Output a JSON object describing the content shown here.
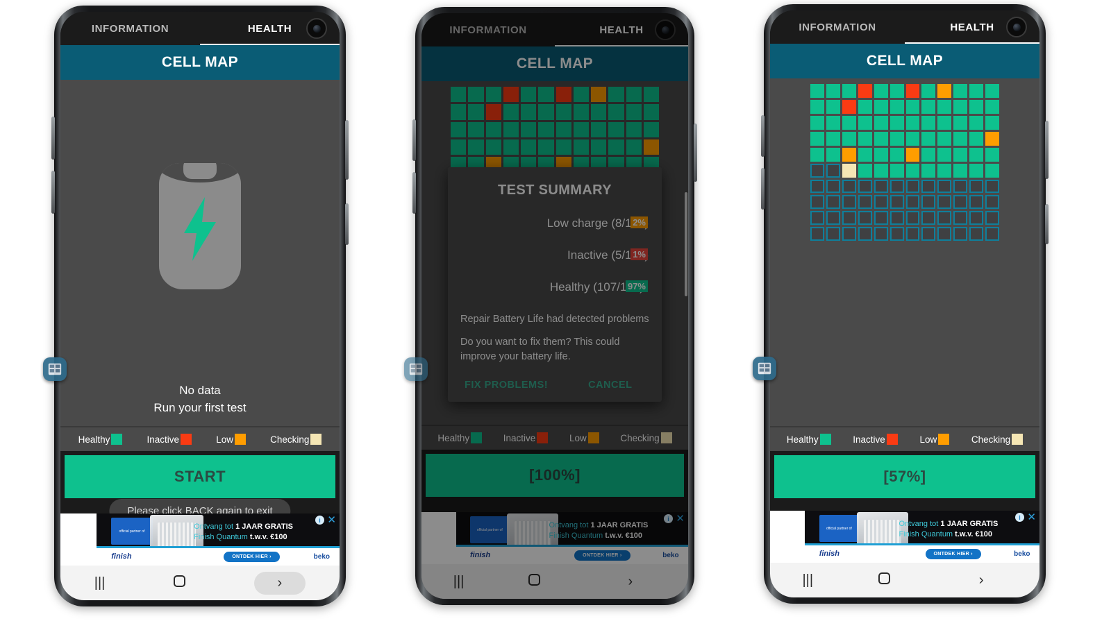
{
  "app": {
    "tabs": {
      "information": "INFORMATION",
      "health": "HEALTH"
    },
    "section_header": "CELL MAP",
    "legend": [
      {
        "label": "Healthy",
        "color": "#0ec18e"
      },
      {
        "label": "Inactive",
        "color": "#fa3b13"
      },
      {
        "label": "Low",
        "color": "#ff9d00"
      },
      {
        "label": "Checking",
        "color": "#f5e6b4"
      }
    ],
    "bubble_icon": "cell-map-widget-icon",
    "camera_icon": "front-camera-icon"
  },
  "phone1": {
    "empty_state": {
      "line1": "No data",
      "line2": "Run your first test",
      "icon": "battery-charging-icon"
    },
    "action_button": "START",
    "toast": "Please click BACK again to exit"
  },
  "phone2": {
    "action_button": "[100%]",
    "dialog": {
      "title": "TEST SUMMARY",
      "stats": [
        {
          "label": "Low charge (8/120)",
          "percent": "2%",
          "color": "#ff9d00"
        },
        {
          "label": "Inactive (5/120)",
          "percent": "1%",
          "color": "#e8453c"
        },
        {
          "label": "Healthy (107/120)",
          "percent": "97%",
          "color": "#0ec18e"
        }
      ],
      "paragraph1": "Repair Battery Life had detected problems",
      "paragraph2": "Do you want to fix them? This could improve your battery life.",
      "confirm": "FIX PROBLEMS!",
      "cancel": "CANCEL"
    }
  },
  "phone3": {
    "action_button": "[57%]"
  },
  "ad": {
    "headline_prefix": "Ontvang tot ",
    "headline_bold": "1 JAAR GRATIS",
    "subline_prefix": "Finish Quantum ",
    "subline_bold": "t.w.v. €100",
    "brand": "finish",
    "cta": "ONTDEK HIER ›",
    "partner": "beko",
    "badge_text": "official partner of",
    "info_icon": "ad-info-icon",
    "close_icon": "ad-close-icon"
  },
  "navbar": {
    "recents": "|||",
    "home": "home-square-icon",
    "back": "›"
  },
  "cellmap": {
    "columns": 12,
    "rows": 10,
    "total_cells": 120,
    "phone2_grid": [
      "h",
      "h",
      "h",
      "i",
      "h",
      "h",
      "i",
      "h",
      "l",
      "h",
      "h",
      "h",
      "h",
      "h",
      "i",
      "h",
      "h",
      "h",
      "h",
      "h",
      "h",
      "h",
      "h",
      "h",
      "h",
      "h",
      "h",
      "h",
      "h",
      "h",
      "h",
      "h",
      "h",
      "h",
      "h",
      "h",
      "h",
      "h",
      "h",
      "h",
      "h",
      "h",
      "h",
      "h",
      "h",
      "h",
      "h",
      "l",
      "h",
      "h",
      "l",
      "h",
      "h",
      "h",
      "l",
      "h",
      "h",
      "h",
      "h",
      "h",
      "h",
      "h",
      "h",
      "h",
      "h",
      "h",
      "h",
      "h",
      "h",
      "h",
      "h",
      "h",
      "h",
      "h",
      "h",
      "h",
      "h",
      "h",
      "h",
      "h",
      "h",
      "h",
      "h",
      "h",
      "h",
      "h",
      "h",
      "h",
      "h",
      "h",
      "h",
      "h",
      "h",
      "h",
      "h",
      "h",
      "h",
      "h",
      "h",
      "h",
      "h",
      "h",
      "h",
      "h",
      "h",
      "h",
      "h",
      "h",
      "h",
      "h",
      "h",
      "h",
      "h",
      "h",
      "h",
      "h",
      "h",
      "h",
      "h",
      "h"
    ],
    "phone3_grid": [
      "h",
      "h",
      "h",
      "i",
      "h",
      "h",
      "i",
      "h",
      "l",
      "h",
      "h",
      "h",
      "h",
      "h",
      "i",
      "h",
      "h",
      "h",
      "h",
      "h",
      "h",
      "h",
      "h",
      "h",
      "h",
      "h",
      "h",
      "h",
      "h",
      "h",
      "h",
      "h",
      "h",
      "h",
      "h",
      "h",
      "h",
      "h",
      "h",
      "h",
      "h",
      "h",
      "h",
      "h",
      "h",
      "h",
      "h",
      "l",
      "h",
      "h",
      "l",
      "h",
      "h",
      "h",
      "l",
      "h",
      "h",
      "h",
      "h",
      "h",
      "e",
      "e",
      "c",
      "h",
      "h",
      "h",
      "h",
      "h",
      "h",
      "h",
      "h",
      "h",
      "e",
      "e",
      "e",
      "e",
      "e",
      "e",
      "e",
      "e",
      "e",
      "e",
      "e",
      "e",
      "e",
      "e",
      "e",
      "e",
      "e",
      "e",
      "e",
      "e",
      "e",
      "e",
      "e",
      "e",
      "e",
      "e",
      "e",
      "e",
      "e",
      "e",
      "e",
      "e",
      "e",
      "e",
      "e",
      "e",
      "e",
      "e",
      "e",
      "e",
      "e",
      "e",
      "e",
      "e",
      "e",
      "e",
      "e",
      "e"
    ]
  }
}
